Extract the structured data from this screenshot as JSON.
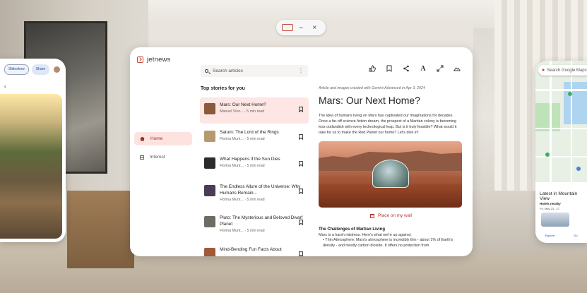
{
  "window_controls": {
    "minimize": "–",
    "close": "×"
  },
  "photos_panel": {
    "chip_slideshow": "Slideshow",
    "chip_share": "Share"
  },
  "maps_panel": {
    "search_placeholder": "Search Google Maps",
    "title": "Latest in Mountain View",
    "subtitle": "Hotels nearby",
    "subtitle_date": "Fri, May 23 - 27",
    "nav_explore": "Explore",
    "nav_go": "Go"
  },
  "app": {
    "brand": "jetnews",
    "nav": [
      {
        "label": "Home"
      },
      {
        "label": "Interest"
      }
    ],
    "search_placeholder": "Search articles",
    "top_stories_heading": "Top stories for you",
    "stories": [
      {
        "title": "Mars: Our Next Home?",
        "meta": "Manuel Vivo... · 5 min read",
        "thumb": "#8a5a3a"
      },
      {
        "title": "Saturn: The Lord of the Rings",
        "meta": "Florina Munt... · 5 min read",
        "thumb": "#b69a6d"
      },
      {
        "title": "What Happens if the Sun Dies",
        "meta": "Florina Munt... · 5 min read",
        "thumb": "#2b2b2b"
      },
      {
        "title": "The Endless Allure of the Universe: Why Humans Remain...",
        "meta": "Florina Munt... · 5 min read",
        "thumb": "#4a3c55"
      },
      {
        "title": "Pluto: The Mysterious and Beloved Dwarf Planet",
        "meta": "Florina Munt... · 5 min read",
        "thumb": "#6e6a64"
      },
      {
        "title": "Mind-Bending Fun Facts About",
        "meta": "",
        "thumb": "#a05a3a"
      }
    ],
    "article": {
      "caption": "Article and images created with Gemini Advanced in Apr 3, 2024",
      "title": "Mars: Our Next Home?",
      "lead": "The idea of humans living on Mars has captivated our imaginations for decades. Once a far-off science fiction dream, the prospect of a Martian colony is becoming less outlandish with every technological leap. But is it truly feasible? What would it take for us to make the Red Planet our home? Let's dive in!",
      "place_button": "Place on my wall",
      "section_title": "The Challenges of Martian Living",
      "section_intro": "Mars is a harsh mistress. Here's what we're up against:",
      "bullet": "Thin Atmosphere: Mars's atmosphere is incredibly thin - about 1% of Earth's density - and mostly carbon dioxide. It offers no protection from"
    }
  }
}
